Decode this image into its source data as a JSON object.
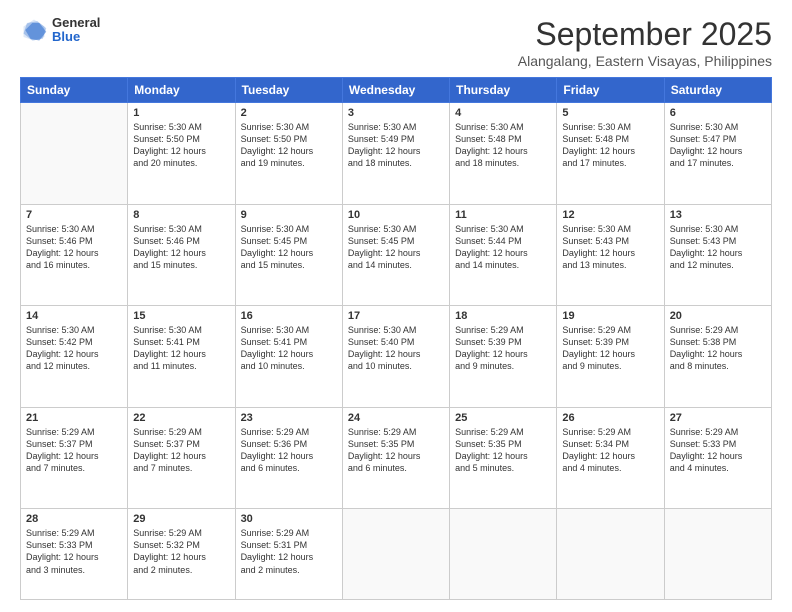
{
  "header": {
    "logo": {
      "general": "General",
      "blue": "Blue"
    },
    "title": "September 2025",
    "location": "Alangalang, Eastern Visayas, Philippines"
  },
  "weekdays": [
    "Sunday",
    "Monday",
    "Tuesday",
    "Wednesday",
    "Thursday",
    "Friday",
    "Saturday"
  ],
  "weeks": [
    [
      {
        "day": "",
        "text": ""
      },
      {
        "day": "1",
        "text": "Sunrise: 5:30 AM\nSunset: 5:50 PM\nDaylight: 12 hours\nand 20 minutes."
      },
      {
        "day": "2",
        "text": "Sunrise: 5:30 AM\nSunset: 5:50 PM\nDaylight: 12 hours\nand 19 minutes."
      },
      {
        "day": "3",
        "text": "Sunrise: 5:30 AM\nSunset: 5:49 PM\nDaylight: 12 hours\nand 18 minutes."
      },
      {
        "day": "4",
        "text": "Sunrise: 5:30 AM\nSunset: 5:48 PM\nDaylight: 12 hours\nand 18 minutes."
      },
      {
        "day": "5",
        "text": "Sunrise: 5:30 AM\nSunset: 5:48 PM\nDaylight: 12 hours\nand 17 minutes."
      },
      {
        "day": "6",
        "text": "Sunrise: 5:30 AM\nSunset: 5:47 PM\nDaylight: 12 hours\nand 17 minutes."
      }
    ],
    [
      {
        "day": "7",
        "text": "Sunrise: 5:30 AM\nSunset: 5:46 PM\nDaylight: 12 hours\nand 16 minutes."
      },
      {
        "day": "8",
        "text": "Sunrise: 5:30 AM\nSunset: 5:46 PM\nDaylight: 12 hours\nand 15 minutes."
      },
      {
        "day": "9",
        "text": "Sunrise: 5:30 AM\nSunset: 5:45 PM\nDaylight: 12 hours\nand 15 minutes."
      },
      {
        "day": "10",
        "text": "Sunrise: 5:30 AM\nSunset: 5:45 PM\nDaylight: 12 hours\nand 14 minutes."
      },
      {
        "day": "11",
        "text": "Sunrise: 5:30 AM\nSunset: 5:44 PM\nDaylight: 12 hours\nand 14 minutes."
      },
      {
        "day": "12",
        "text": "Sunrise: 5:30 AM\nSunset: 5:43 PM\nDaylight: 12 hours\nand 13 minutes."
      },
      {
        "day": "13",
        "text": "Sunrise: 5:30 AM\nSunset: 5:43 PM\nDaylight: 12 hours\nand 12 minutes."
      }
    ],
    [
      {
        "day": "14",
        "text": "Sunrise: 5:30 AM\nSunset: 5:42 PM\nDaylight: 12 hours\nand 12 minutes."
      },
      {
        "day": "15",
        "text": "Sunrise: 5:30 AM\nSunset: 5:41 PM\nDaylight: 12 hours\nand 11 minutes."
      },
      {
        "day": "16",
        "text": "Sunrise: 5:30 AM\nSunset: 5:41 PM\nDaylight: 12 hours\nand 10 minutes."
      },
      {
        "day": "17",
        "text": "Sunrise: 5:30 AM\nSunset: 5:40 PM\nDaylight: 12 hours\nand 10 minutes."
      },
      {
        "day": "18",
        "text": "Sunrise: 5:29 AM\nSunset: 5:39 PM\nDaylight: 12 hours\nand 9 minutes."
      },
      {
        "day": "19",
        "text": "Sunrise: 5:29 AM\nSunset: 5:39 PM\nDaylight: 12 hours\nand 9 minutes."
      },
      {
        "day": "20",
        "text": "Sunrise: 5:29 AM\nSunset: 5:38 PM\nDaylight: 12 hours\nand 8 minutes."
      }
    ],
    [
      {
        "day": "21",
        "text": "Sunrise: 5:29 AM\nSunset: 5:37 PM\nDaylight: 12 hours\nand 7 minutes."
      },
      {
        "day": "22",
        "text": "Sunrise: 5:29 AM\nSunset: 5:37 PM\nDaylight: 12 hours\nand 7 minutes."
      },
      {
        "day": "23",
        "text": "Sunrise: 5:29 AM\nSunset: 5:36 PM\nDaylight: 12 hours\nand 6 minutes."
      },
      {
        "day": "24",
        "text": "Sunrise: 5:29 AM\nSunset: 5:35 PM\nDaylight: 12 hours\nand 6 minutes."
      },
      {
        "day": "25",
        "text": "Sunrise: 5:29 AM\nSunset: 5:35 PM\nDaylight: 12 hours\nand 5 minutes."
      },
      {
        "day": "26",
        "text": "Sunrise: 5:29 AM\nSunset: 5:34 PM\nDaylight: 12 hours\nand 4 minutes."
      },
      {
        "day": "27",
        "text": "Sunrise: 5:29 AM\nSunset: 5:33 PM\nDaylight: 12 hours\nand 4 minutes."
      }
    ],
    [
      {
        "day": "28",
        "text": "Sunrise: 5:29 AM\nSunset: 5:33 PM\nDaylight: 12 hours\nand 3 minutes."
      },
      {
        "day": "29",
        "text": "Sunrise: 5:29 AM\nSunset: 5:32 PM\nDaylight: 12 hours\nand 2 minutes."
      },
      {
        "day": "30",
        "text": "Sunrise: 5:29 AM\nSunset: 5:31 PM\nDaylight: 12 hours\nand 2 minutes."
      },
      {
        "day": "",
        "text": ""
      },
      {
        "day": "",
        "text": ""
      },
      {
        "day": "",
        "text": ""
      },
      {
        "day": "",
        "text": ""
      }
    ]
  ]
}
